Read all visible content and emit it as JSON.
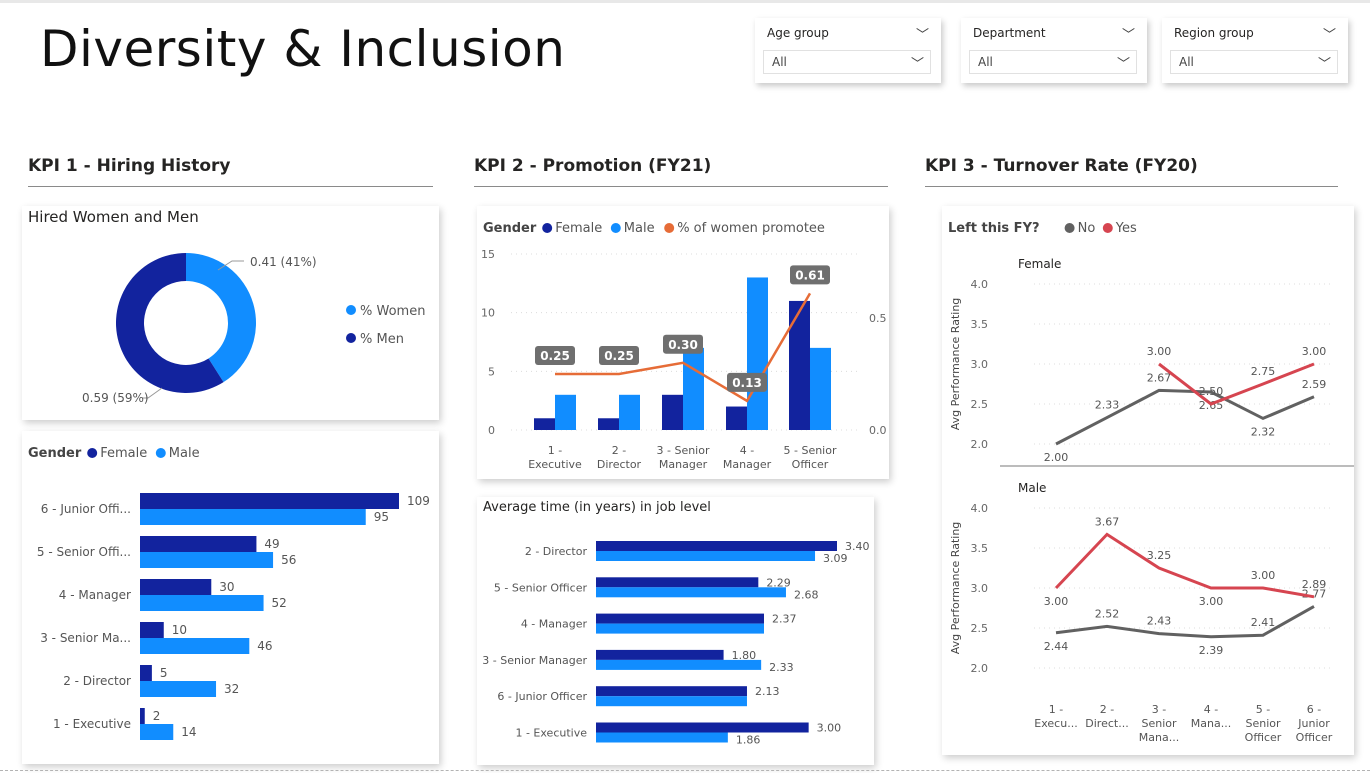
{
  "page": {
    "title": "Diversity & Inclusion",
    "slicers": [
      {
        "label": "Age group",
        "value": "All"
      },
      {
        "label": "Department",
        "value": "All"
      },
      {
        "label": "Region group",
        "value": "All"
      }
    ],
    "sections": [
      "KPI 1 - Hiring History",
      "KPI 2 - Promotion (FY21)",
      "KPI 3 - Turnover Rate (FY20)"
    ],
    "colors": {
      "female": "#12239e",
      "male": "#118dff",
      "line": "#e66c37",
      "no": "#616161",
      "yes": "#d64550"
    }
  },
  "chart_data": [
    {
      "type": "pie",
      "title": "Hired Women and Men",
      "legend": [
        "% Women",
        "% Men"
      ],
      "values": [
        0.41,
        0.59
      ],
      "data_labels": [
        "0.41 (41%)",
        "0.59 (59%)"
      ],
      "legend_placement": "right"
    },
    {
      "type": "bar",
      "orientation": "horizontal",
      "legend_title": "Gender",
      "legend": [
        "Female",
        "Male"
      ],
      "categories": [
        "6 - Junior Offi...",
        "5 - Senior Offi...",
        "4 - Manager",
        "3 - Senior Ma...",
        "2 - Director",
        "1 - Executive"
      ],
      "series": [
        {
          "name": "Female",
          "values": [
            109,
            49,
            30,
            10,
            5,
            2
          ]
        },
        {
          "name": "Male",
          "values": [
            95,
            56,
            52,
            46,
            32,
            14
          ]
        }
      ]
    },
    {
      "type": "bar",
      "legend_title": "Gender",
      "legend": [
        "Female",
        "Male",
        "% of women promotee"
      ],
      "categories": [
        "1 - Executive",
        "2 - Director",
        "3 - Senior Manager",
        "4 - Manager",
        "5 - Senior Officer"
      ],
      "category_lines": [
        [
          "1 -",
          "Executive"
        ],
        [
          "2 -",
          "Director"
        ],
        [
          "3 - Senior",
          "Manager"
        ],
        [
          "4 -",
          "Manager"
        ],
        [
          "5 - Senior",
          "Officer"
        ]
      ],
      "series": [
        {
          "name": "Female",
          "values": [
            1,
            1,
            3,
            2,
            11
          ]
        },
        {
          "name": "Male",
          "values": [
            3,
            3,
            7,
            13,
            7
          ]
        }
      ],
      "line_series": {
        "name": "% of women promotee",
        "values": [
          0.25,
          0.25,
          0.3,
          0.13,
          0.61
        ],
        "labels": [
          "0.25",
          "0.25",
          "0.30",
          "0.13",
          "0.61"
        ]
      },
      "ylim": [
        0,
        15
      ],
      "y_ticks": [
        "0",
        "5",
        "10",
        "15"
      ],
      "y2_ticks": [
        "0.0",
        "0.5"
      ]
    },
    {
      "type": "bar",
      "orientation": "horizontal",
      "title": "Average time (in years) in job level",
      "categories": [
        "2 - Director",
        "5 - Senior Officer",
        "4 - Manager",
        "3 - Senior Manager",
        "6 - Junior Officer",
        "1 - Executive"
      ],
      "series": [
        {
          "name": "Female",
          "values": [
            3.4,
            2.29,
            2.37,
            1.8,
            2.13,
            3.0
          ],
          "labels": [
            "3.40",
            "2.29",
            "2.37",
            "1.80",
            "2.13",
            "3.00"
          ]
        },
        {
          "name": "Male",
          "values": [
            3.09,
            2.68,
            2.37,
            2.33,
            2.13,
            1.86
          ],
          "labels": [
            "3.09",
            "2.68",
            "",
            "2.33",
            "",
            "1.86"
          ]
        }
      ]
    },
    {
      "type": "line",
      "legend_title": "Left this FY?",
      "legend": [
        "No",
        "Yes"
      ],
      "ylabel": "Avg Performance Rating",
      "x": [
        "1 - Execu...",
        "2 - Direct...",
        "3 - Senior Mana...",
        "4 - Mana...",
        "5 - Senior Officer",
        "6 - Junior Officer"
      ],
      "x_lines": [
        [
          "1 -",
          "Execu..."
        ],
        [
          "2 -",
          "Direct..."
        ],
        [
          "3 -",
          "Senior",
          "Mana..."
        ],
        [
          "4 -",
          "Mana..."
        ],
        [
          "5 -",
          "Senior",
          "Officer"
        ],
        [
          "6 -",
          "Junior",
          "Officer"
        ]
      ],
      "y_ticks": [
        "2.0",
        "2.5",
        "3.0",
        "3.5",
        "4.0"
      ],
      "ylim": [
        2.0,
        4.0
      ],
      "panels": [
        {
          "name": "Female",
          "series": [
            {
              "name": "No",
              "values": [
                2.0,
                2.33,
                2.67,
                2.65,
                2.32,
                2.59
              ],
              "labels": [
                "2.00",
                "2.33",
                "2.67",
                "2.65",
                "2.32",
                "2.59"
              ]
            },
            {
              "name": "Yes",
              "values": [
                null,
                null,
                3.0,
                2.5,
                2.75,
                3.0
              ],
              "labels": [
                "",
                "",
                "3.00",
                "2.50",
                "2.75",
                "3.00"
              ]
            }
          ]
        },
        {
          "name": "Male",
          "series": [
            {
              "name": "No",
              "values": [
                2.44,
                2.52,
                2.43,
                2.39,
                2.41,
                2.77
              ],
              "labels": [
                "2.44",
                "2.52",
                "2.43",
                "2.39",
                "2.41",
                "2.77"
              ]
            },
            {
              "name": "Yes",
              "values": [
                3.0,
                3.67,
                3.25,
                3.0,
                3.0,
                2.89
              ],
              "labels": [
                "3.00",
                "3.67",
                "3.25",
                "3.00",
                "3.00",
                "2.89"
              ]
            }
          ]
        }
      ]
    }
  ]
}
